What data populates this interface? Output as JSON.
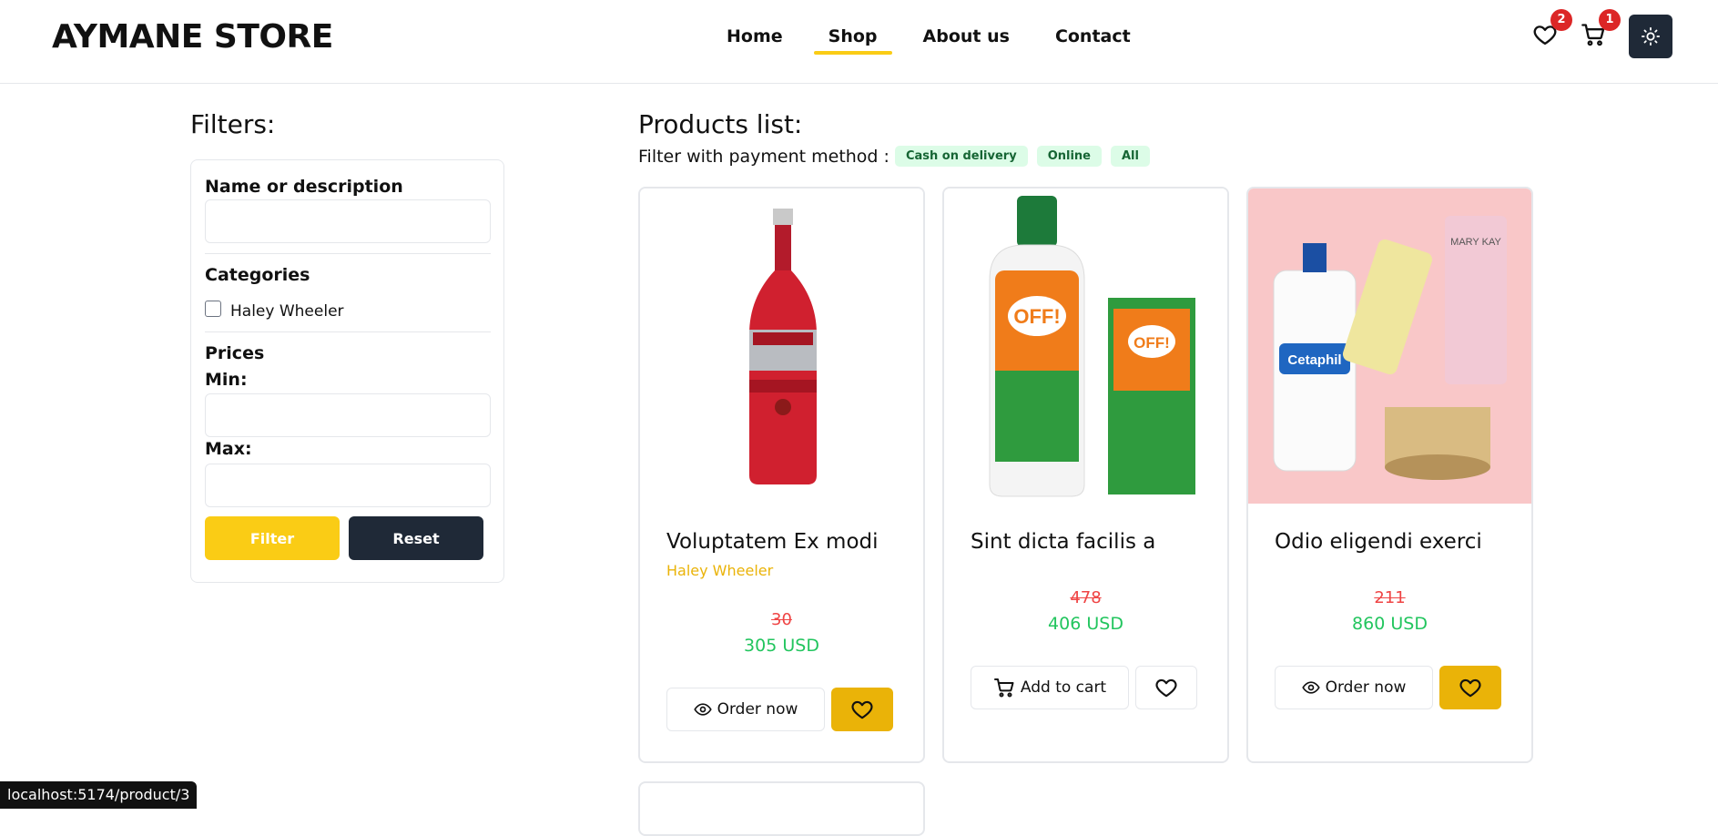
{
  "header": {
    "brand": "AYMANE STORE",
    "nav": [
      {
        "label": "Home",
        "active": false
      },
      {
        "label": "Shop",
        "active": true
      },
      {
        "label": "About us",
        "active": false
      },
      {
        "label": "Contact",
        "active": false
      }
    ],
    "wishlist_count": "2",
    "cart_count": "1",
    "icons": [
      "heart-icon",
      "cart-icon",
      "sun-icon"
    ]
  },
  "filters": {
    "title": "Filters:",
    "name_label": "Name or description",
    "name_value": "",
    "categories_label": "Categories",
    "categories": [
      {
        "label": "Haley Wheeler",
        "checked": false
      }
    ],
    "prices_label": "Prices",
    "min_label": "Min:",
    "min_value": "",
    "max_label": "Max:",
    "max_value": "",
    "filter_button": "Filter",
    "reset_button": "Reset"
  },
  "products": {
    "title": "Products list:",
    "payment_label": "Filter with payment method :",
    "payment_options": [
      "Cash on delivery",
      "Online",
      "All"
    ],
    "items": [
      {
        "name": "Voluptatem Ex modi",
        "category": "Haley Wheeler",
        "old_price": "30",
        "price": "305 USD",
        "action": "Order now",
        "action_icon": "eye-icon",
        "wishlisted": true
      },
      {
        "name": "Sint dicta facilis a",
        "category": "",
        "old_price": "478",
        "price": "406 USD",
        "action": "Add to cart",
        "action_icon": "cart-icon",
        "wishlisted": false
      },
      {
        "name": "Odio eligendi exerci",
        "category": "",
        "old_price": "211",
        "price": "860 USD",
        "action": "Order now",
        "action_icon": "eye-icon",
        "wishlisted": true
      }
    ]
  },
  "status_bar": {
    "url": "localhost:5174/product/3"
  },
  "colors": {
    "accent": "#facc15",
    "dark": "#1f2937",
    "price_new": "#22c55e",
    "price_old": "#ef4444",
    "badge": "#dc2626"
  }
}
